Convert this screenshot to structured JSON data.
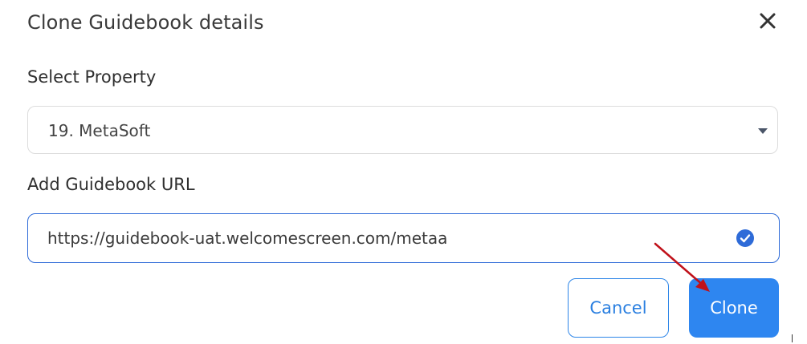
{
  "dialog": {
    "title": "Clone Guidebook details"
  },
  "property": {
    "label": "Select Property",
    "selected": "19. MetaSoft"
  },
  "url": {
    "label": "Add Guidebook URL",
    "value": "https://guidebook-uat.welcomescreen.com/metaa",
    "status": "valid"
  },
  "actions": {
    "cancel_label": "Cancel",
    "clone_label": "Clone"
  },
  "colors": {
    "accent": "#2e86f0",
    "input_focus_border": "#2e6bd8",
    "annotation_arrow": "#c0111a"
  },
  "icons": {
    "close": "close-icon",
    "caret": "caret-down-icon",
    "valid": "check-circle-icon"
  }
}
